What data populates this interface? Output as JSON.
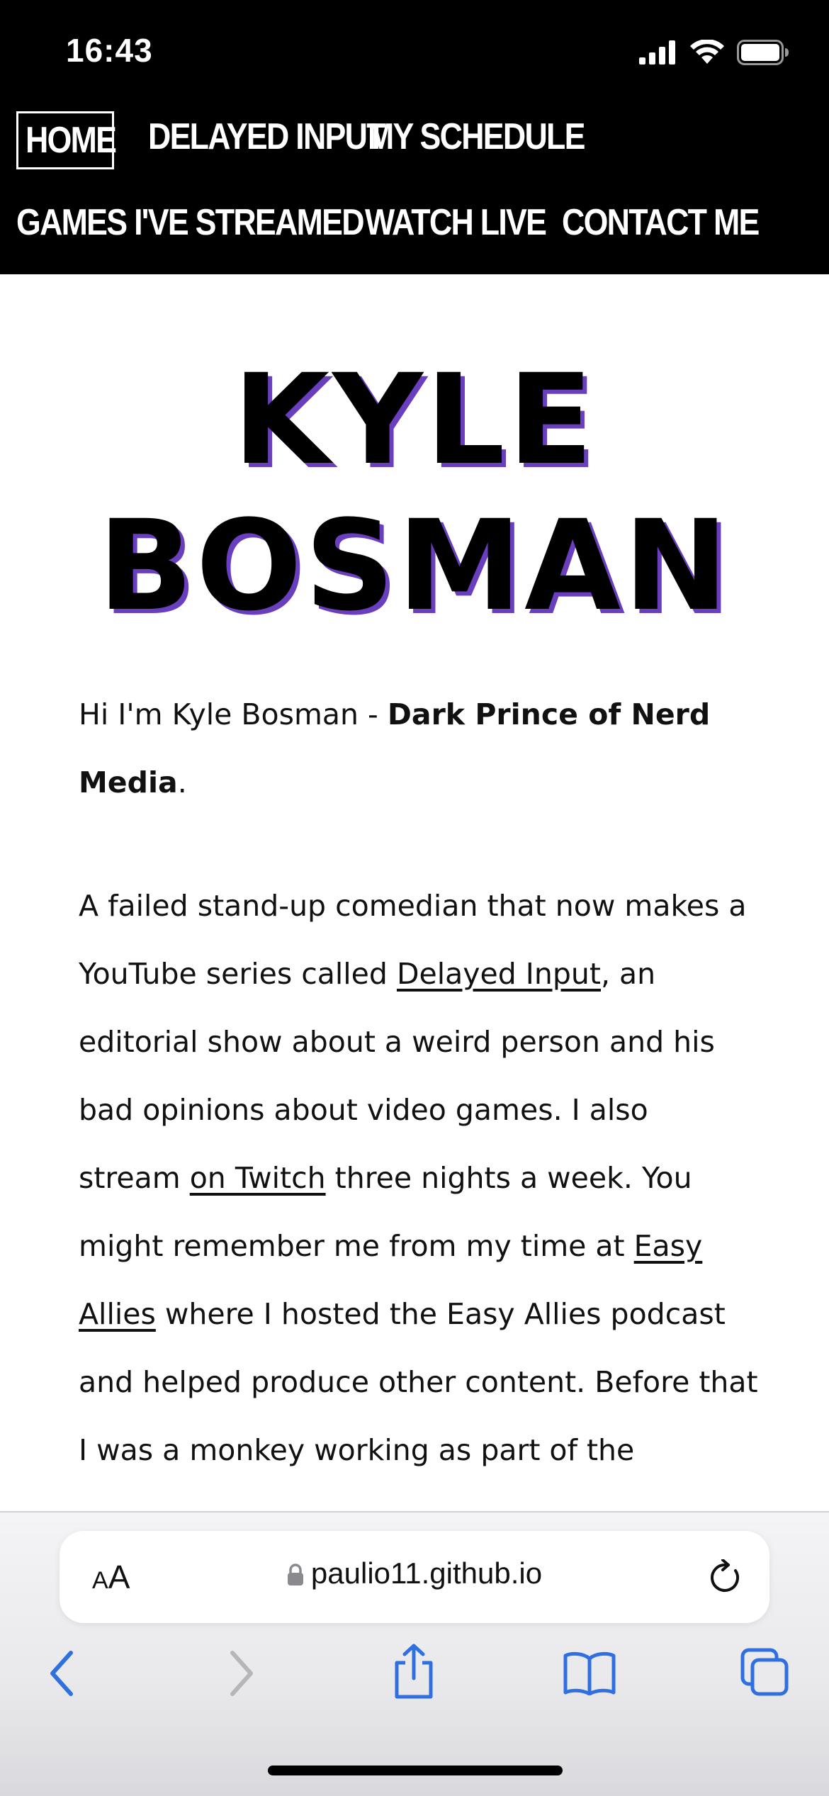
{
  "status": {
    "time": "16:43"
  },
  "nav": {
    "row1": [
      "HOME",
      "DELAYED INPUT",
      "MY SCHEDULE"
    ],
    "row2": [
      "GAMES I'VE STREAMED",
      "WATCH LIVE",
      "CONTACT ME"
    ],
    "active": "HOME"
  },
  "hero": {
    "line1": "KYLE",
    "line2": "BOSMAN"
  },
  "intro": {
    "prefix": "Hi I'm Kyle Bosman - ",
    "bold": "Dark Prince of Nerd Media",
    "suffix": "."
  },
  "bio": {
    "t1": "A failed stand-up comedian that now makes a YouTube series called ",
    "link1": "Delayed Input",
    "t2": ", an editorial show about a weird person and his bad opinions about video games. I also stream ",
    "link2": "on Twitch",
    "t3": " three nights a week. You might remember me from my time at ",
    "link3": "Easy Allies",
    "t4": " where I hosted the Easy Allies podcast and helped produce other content. Before that I was a monkey working as part of the"
  },
  "safari": {
    "text_size_label_small": "A",
    "text_size_label_big": "A",
    "url": "paulio11.github.io"
  },
  "colors": {
    "accent_shadow": "#6a3fbf",
    "toolbar_blue": "#2f6fe0"
  }
}
